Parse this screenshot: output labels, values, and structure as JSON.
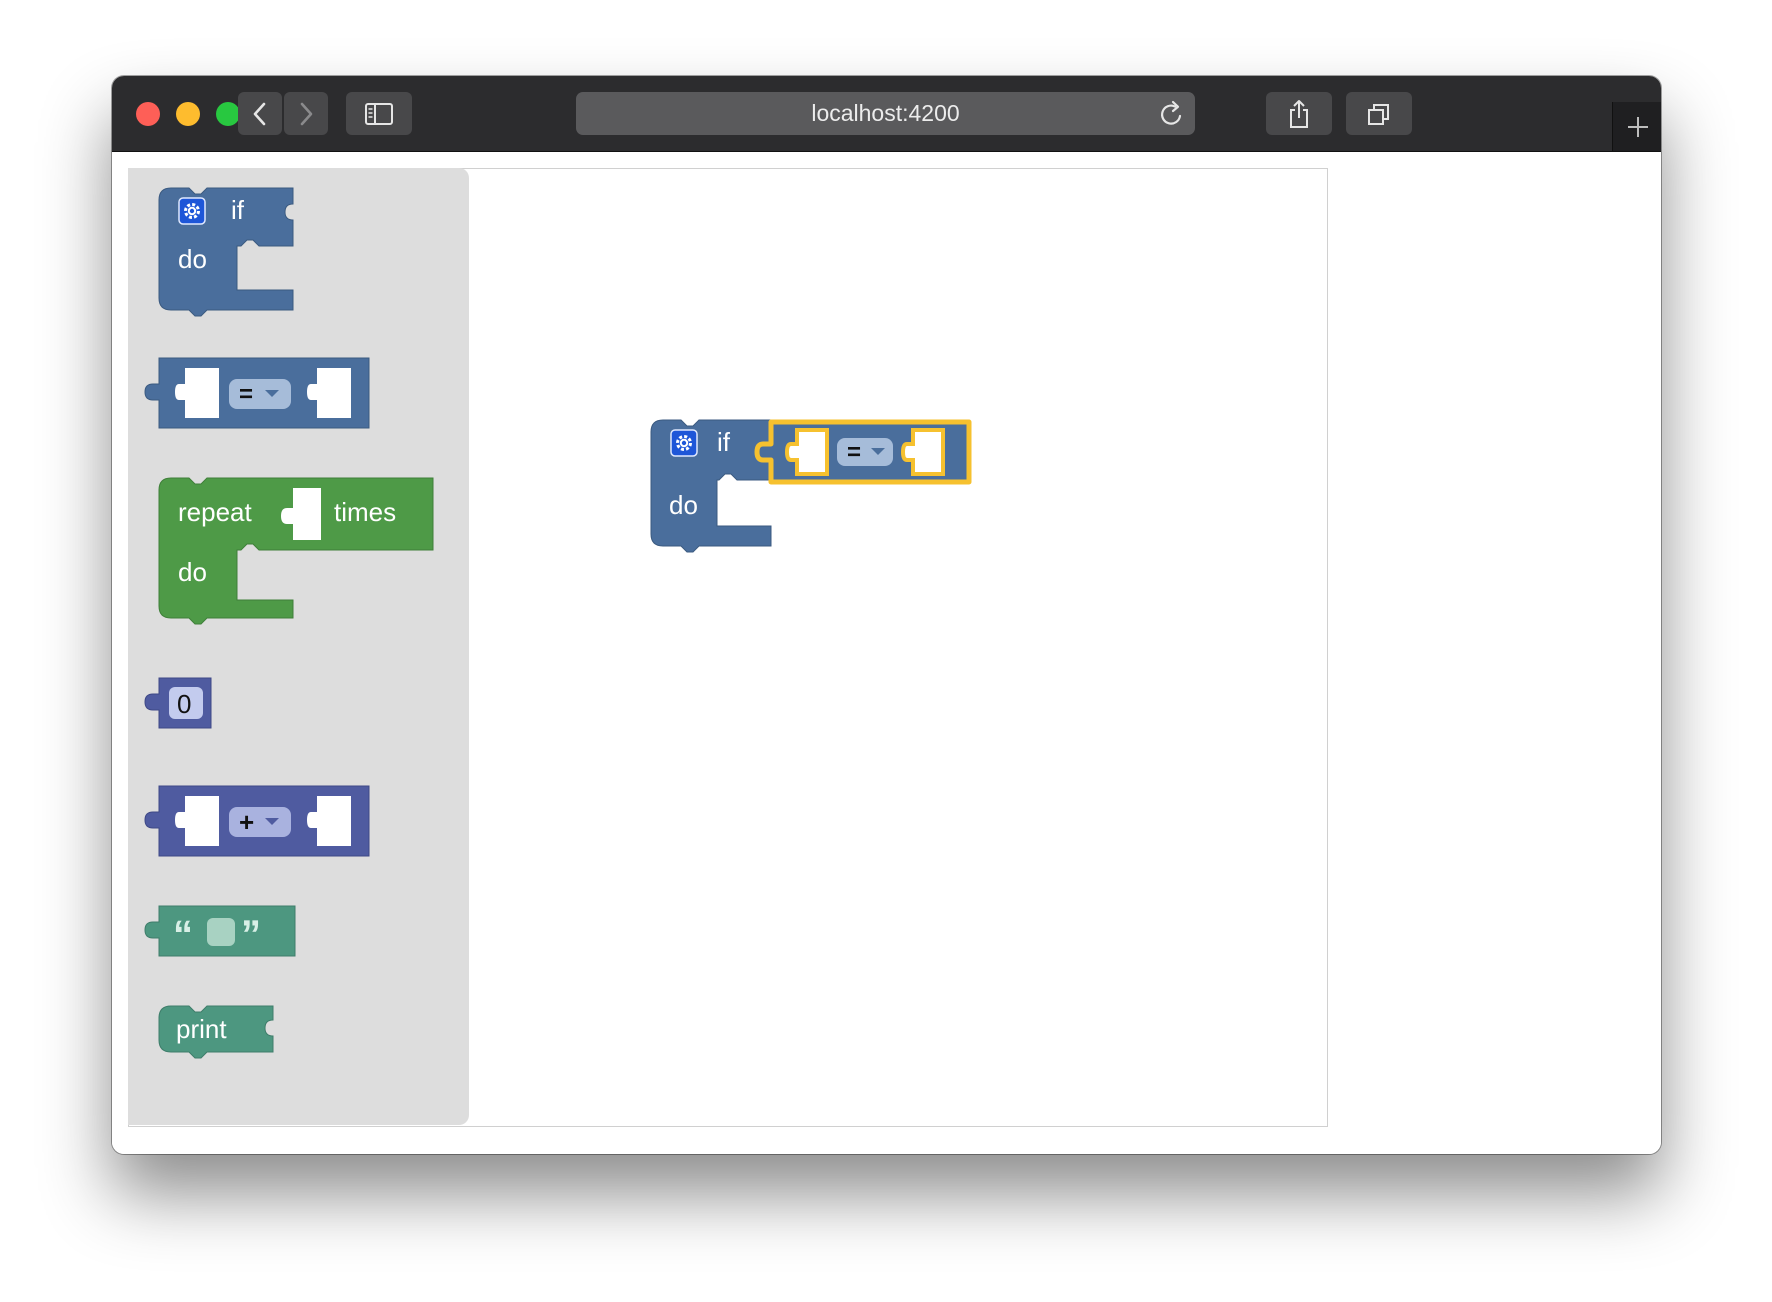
{
  "browser": {
    "url": "localhost:4200",
    "icons": [
      "back-icon",
      "forward-icon",
      "sidebar-icon",
      "reload-icon",
      "share-icon",
      "tabs-icon",
      "new-tab-icon"
    ]
  },
  "toolbox": {
    "if_block": {
      "if_label": "if",
      "do_label": "do",
      "color": "#4a6e9c"
    },
    "compare_block": {
      "operator": "=",
      "color": "#4a6e9c"
    },
    "repeat_block": {
      "repeat_label": "repeat",
      "times_label": "times",
      "do_label": "do",
      "color": "#4e9a47"
    },
    "number_block": {
      "value": "0",
      "color": "#4f5ba0"
    },
    "arithmetic_block": {
      "operator": "+",
      "color": "#4f5ba0"
    },
    "text_block": {
      "open_quote": "“",
      "close_quote": "”",
      "color": "#4d9780"
    },
    "print_block": {
      "label": "print",
      "color": "#4d9780"
    }
  },
  "workspace": {
    "if_block": {
      "if_label": "if",
      "do_label": "do"
    },
    "compare_block": {
      "operator": "=",
      "highlight_color": "#f6c12f"
    }
  },
  "colors": {
    "titlebar": "#2c2c2e",
    "toolbox_bg": "#dddddd",
    "logic": "#4a6e9c",
    "loops": "#4e9a47",
    "math": "#4f5ba0",
    "text": "#4d9780",
    "selection": "#f6c12f"
  }
}
